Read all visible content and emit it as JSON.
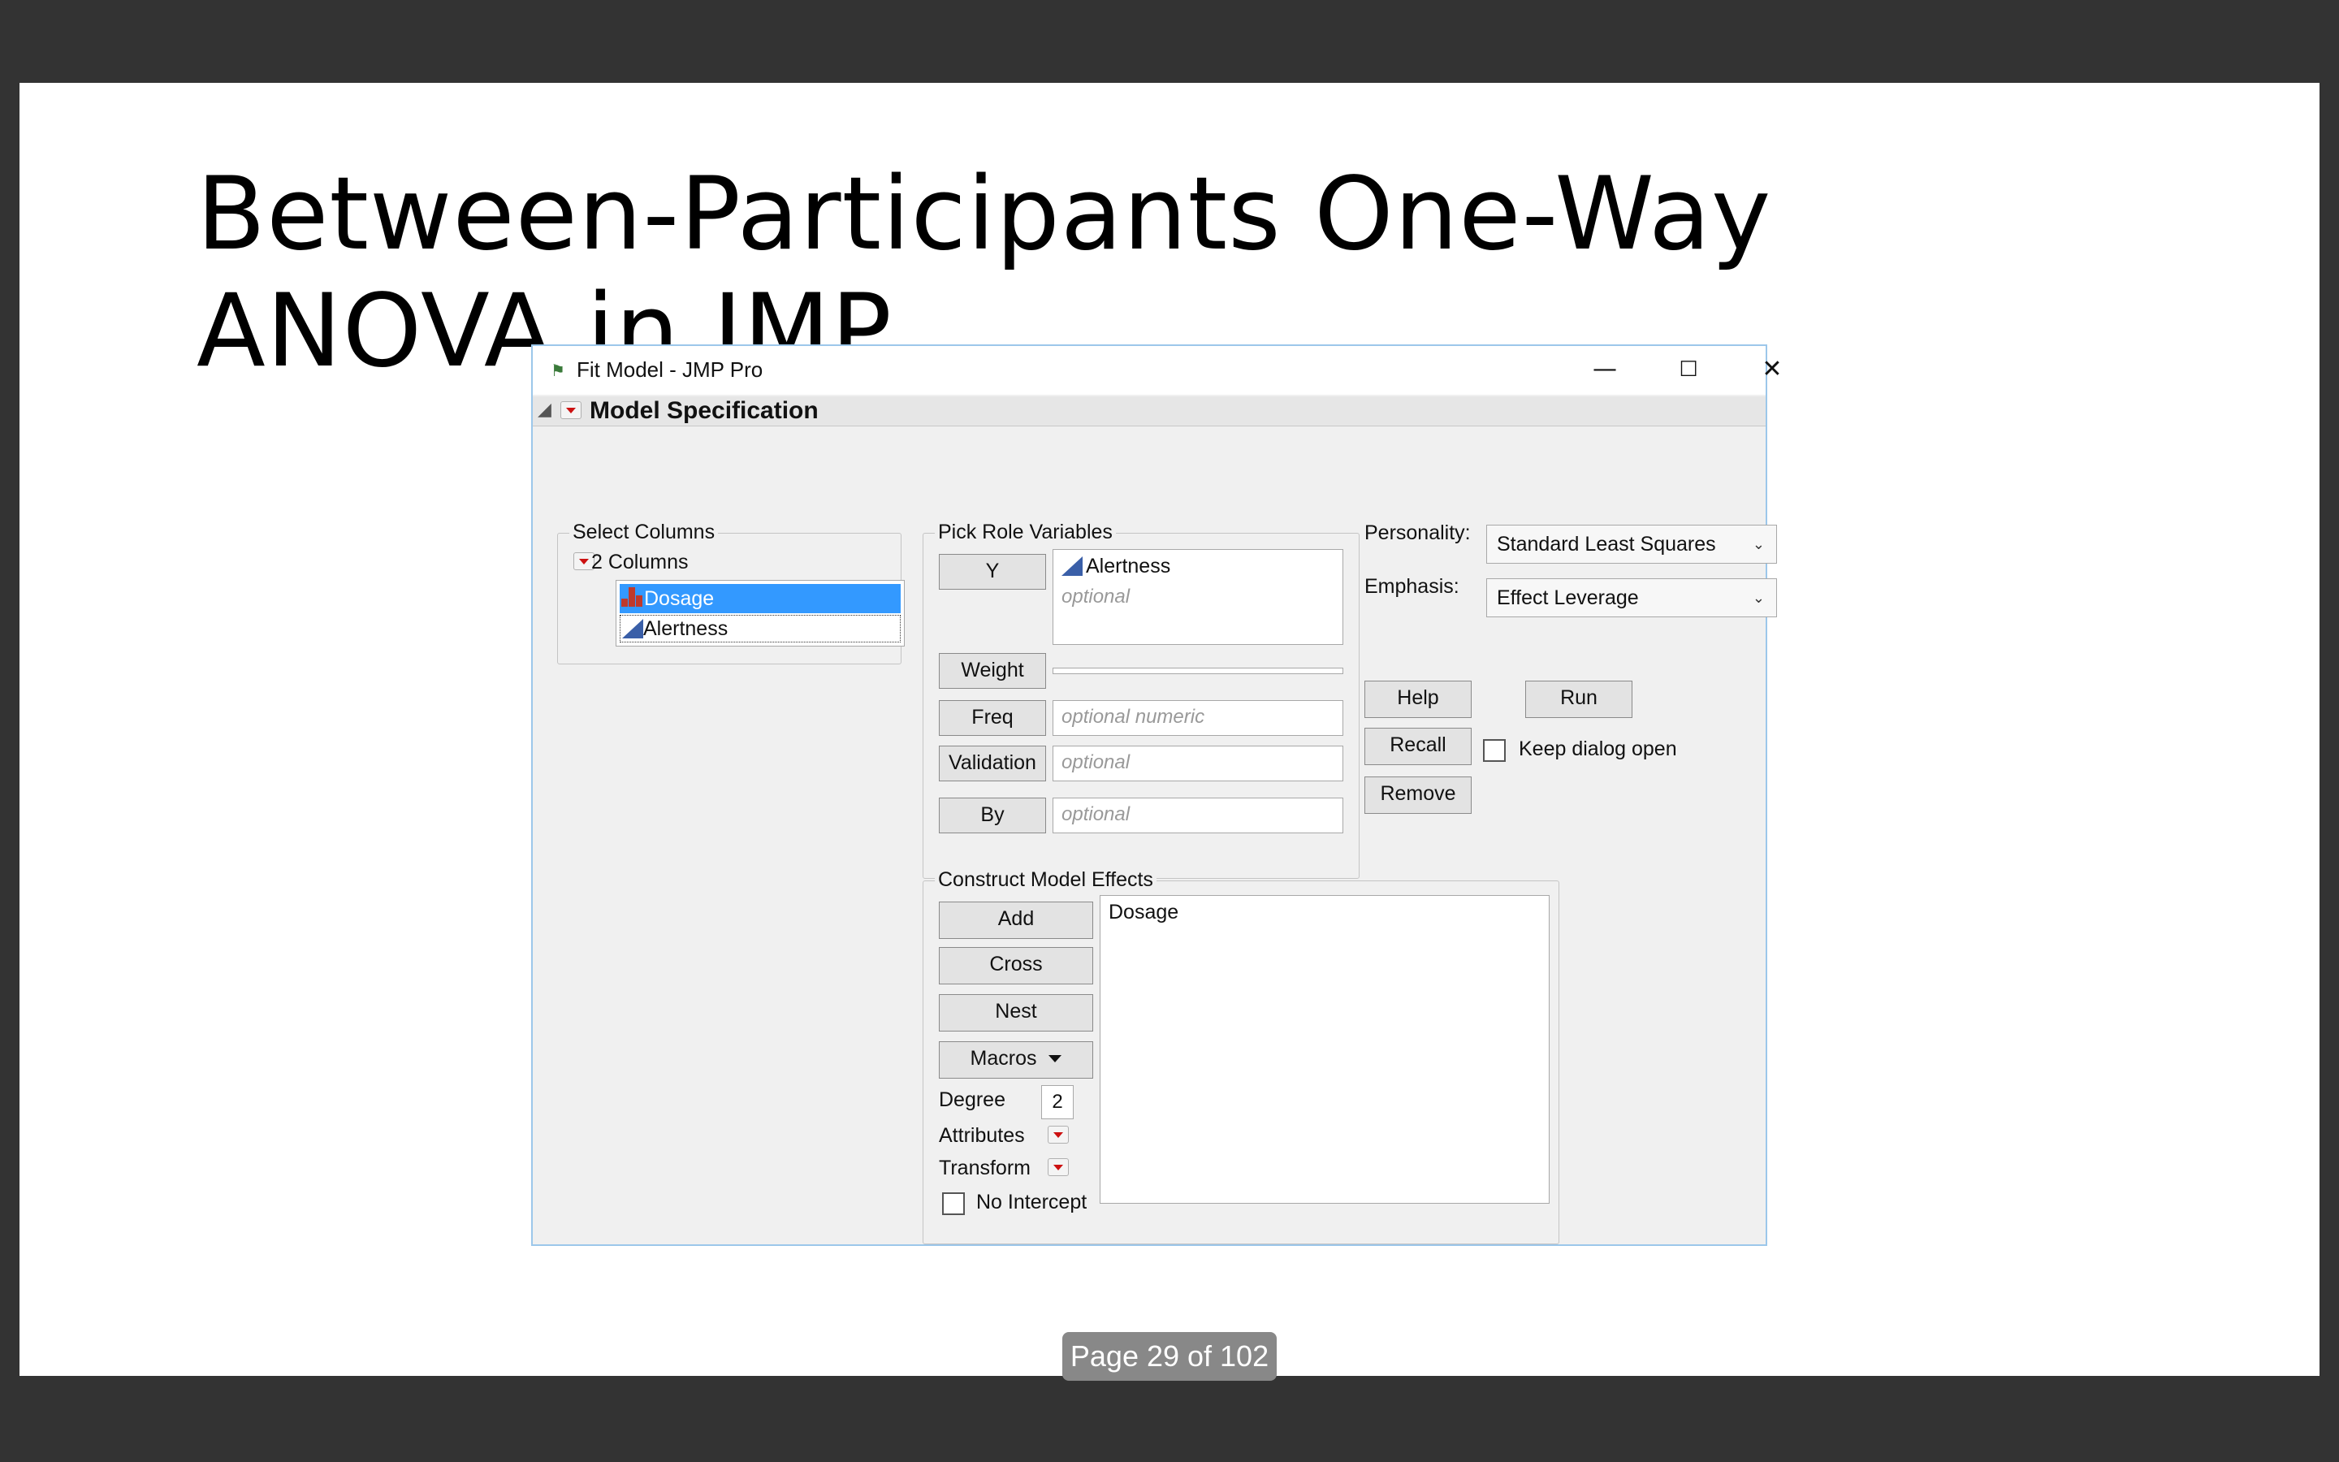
{
  "slide": {
    "title_line1": "Between-Participants One-Way",
    "title_line2": "ANOVA in JMP"
  },
  "window": {
    "title": "Fit Model - JMP Pro",
    "minimize": "—",
    "maximize": "☐",
    "close": "✕"
  },
  "spec": {
    "title": "Model Specification"
  },
  "select_columns": {
    "legend": "Select Columns",
    "count_label": "2 Columns",
    "items": [
      {
        "label": "Dosage",
        "type": "nominal",
        "selected": true
      },
      {
        "label": "Alertness",
        "type": "continuous",
        "selected": false
      }
    ]
  },
  "roles": {
    "legend": "Pick Role Variables",
    "y_button": "Y",
    "y_value": "Alertness",
    "y_placeholder": "optional",
    "weight_button": "Weight",
    "freq_button": "Freq",
    "freq_placeholder": "optional numeric",
    "validation_button": "Validation",
    "validation_placeholder": "optional",
    "by_button": "By",
    "by_placeholder": "optional"
  },
  "options": {
    "personality_label": "Personality:",
    "personality_value": "Standard Least Squares",
    "emphasis_label": "Emphasis:",
    "emphasis_value": "Effect Leverage",
    "help_button": "Help",
    "run_button": "Run",
    "recall_button": "Recall",
    "remove_button": "Remove",
    "keep_open_label": "Keep dialog open"
  },
  "effects": {
    "legend": "Construct Model Effects",
    "add_button": "Add",
    "cross_button": "Cross",
    "nest_button": "Nest",
    "macros_button": "Macros",
    "degree_label": "Degree",
    "degree_value": "2",
    "attributes_label": "Attributes",
    "transform_label": "Transform",
    "no_intercept_label": "No Intercept",
    "items": [
      "Dosage"
    ]
  },
  "footer": {
    "page_indicator": "Page 29 of 102"
  },
  "colors": {
    "selection": "#3399ff",
    "accent_red": "#cc1111",
    "continuous_icon": "#3a5fa8",
    "nominal_icon": "#c0392b"
  }
}
